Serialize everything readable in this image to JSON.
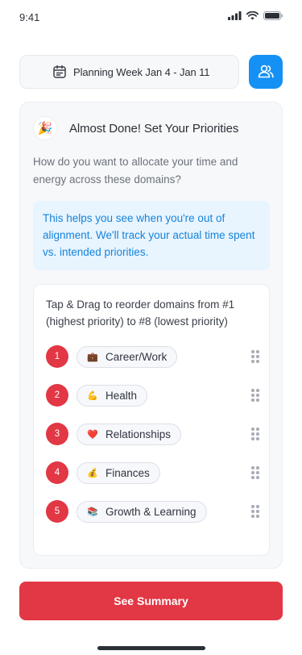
{
  "status_bar": {
    "time": "9:41"
  },
  "header": {
    "week_label": "Planning Week  Jan 4 - Jan 11",
    "calendar_icon": "calendar-icon",
    "team_icon": "users-icon",
    "accent": "#1591f5"
  },
  "card": {
    "title": "Almost Done! Set Your Priorities",
    "title_icon": "🎉",
    "question": "How do you want to allocate your time and energy across these domains?",
    "info": "This helps you see when you're out of alignment. We'll track your actual time spent vs. intended priorities.",
    "instruction": "Tap & Drag to reorder domains from #1 (highest priority) to #8 (lowest priority)"
  },
  "domains": [
    {
      "rank": "1",
      "emoji": "💼",
      "label": "Career/Work"
    },
    {
      "rank": "2",
      "emoji": "💪",
      "label": "Health"
    },
    {
      "rank": "3",
      "emoji": "❤️",
      "label": "Relationships"
    },
    {
      "rank": "4",
      "emoji": "💰",
      "label": "Finances"
    },
    {
      "rank": "5",
      "emoji": "📚",
      "label": "Growth & Learning"
    }
  ],
  "cta": {
    "label": "See Summary",
    "color": "#e23744"
  }
}
